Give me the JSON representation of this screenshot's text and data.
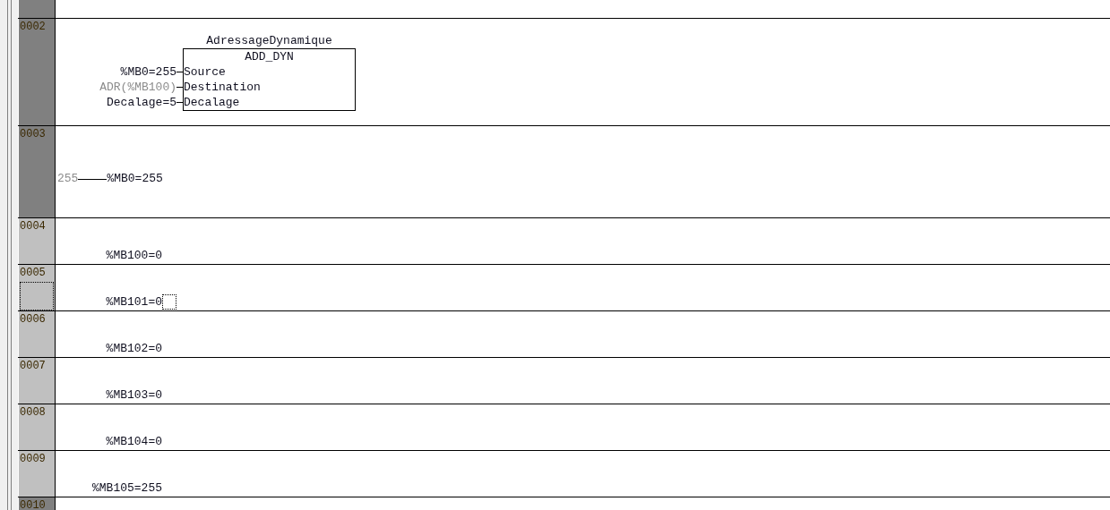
{
  "networks": [
    {
      "number": "0002",
      "selected": true,
      "focused": false,
      "kind": "block",
      "instance": "AdressageDynamique",
      "type": "ADD_DYN",
      "pins": [
        {
          "arg": "%MB0=255",
          "pin": "Source",
          "dim": false
        },
        {
          "arg": "ADR(%MB100)",
          "pin": "Destination",
          "dim": true
        },
        {
          "arg": "Decalage=5",
          "pin": "Decalage",
          "dim": false
        }
      ]
    },
    {
      "number": "0003",
      "selected": true,
      "focused": false,
      "kind": "assign",
      "source": "255",
      "target": "%MB0=255"
    },
    {
      "number": "0004",
      "selected": false,
      "focused": false,
      "kind": "output",
      "text": "%MB100=0"
    },
    {
      "number": "0005",
      "selected": false,
      "focused": true,
      "kind": "output",
      "text": "%MB101=0"
    },
    {
      "number": "0006",
      "selected": false,
      "focused": false,
      "kind": "output",
      "text": "%MB102=0"
    },
    {
      "number": "0007",
      "selected": false,
      "focused": false,
      "kind": "output",
      "text": "%MB103=0"
    },
    {
      "number": "0008",
      "selected": false,
      "focused": false,
      "kind": "output",
      "text": "%MB104=0"
    },
    {
      "number": "0009",
      "selected": false,
      "focused": false,
      "kind": "output",
      "text": "%MB105=255"
    },
    {
      "number": "0010",
      "selected": true,
      "focused": false,
      "kind": "partial"
    }
  ]
}
